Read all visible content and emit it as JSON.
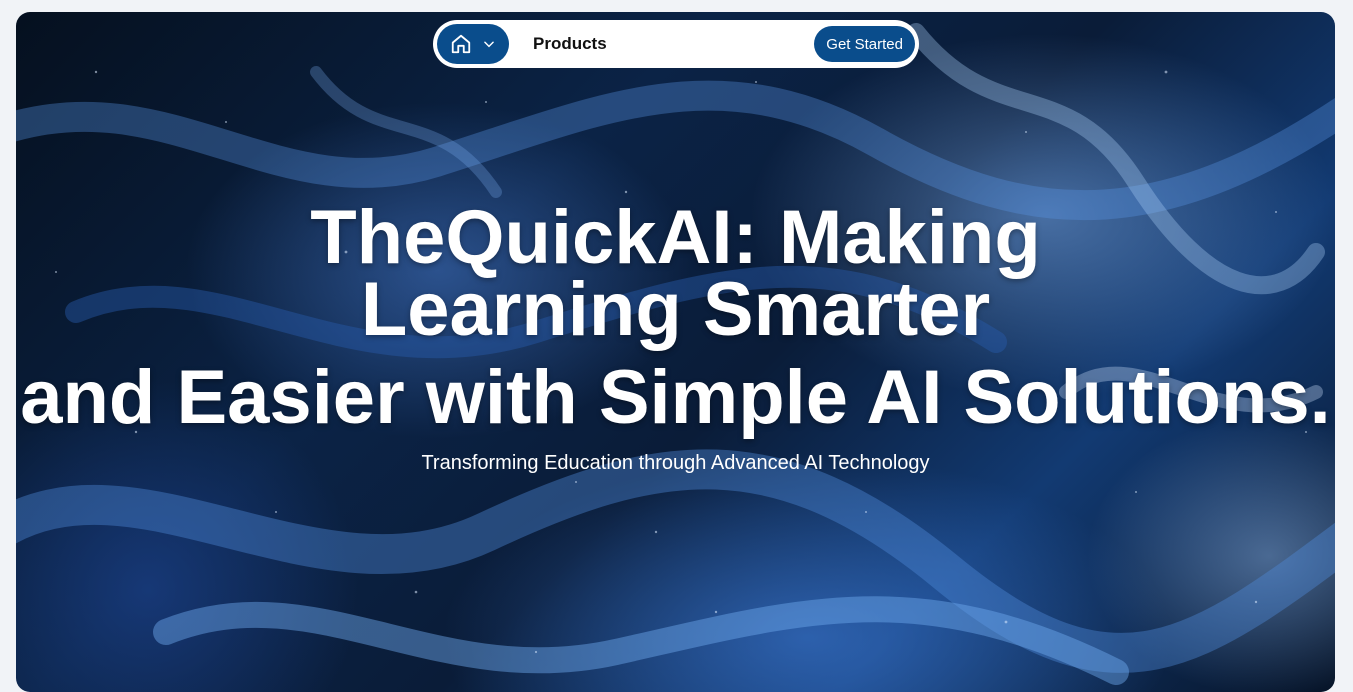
{
  "nav": {
    "home_icon": "home-icon",
    "chevron_icon": "chevron-down-icon",
    "products_label": "Products",
    "cta_label": "Get Started"
  },
  "hero": {
    "headline_line1": "TheQuickAI: Making Learning Smarter",
    "headline_line2": "and Easier with Simple AI Solutions.",
    "subtitle": "Transforming Education through Advanced AI Technology"
  },
  "colors": {
    "accent": "#0a4d8c",
    "page_bg": "#f1f3f7",
    "text_light": "#ffffff"
  }
}
